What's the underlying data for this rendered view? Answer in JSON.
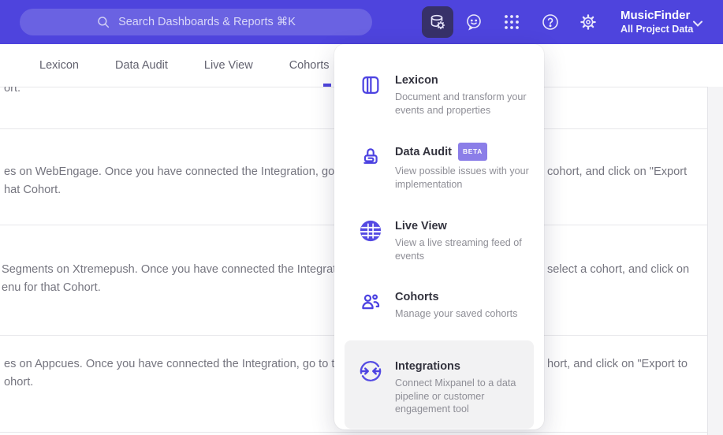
{
  "header": {
    "search_placeholder": "Search Dashboards & Reports ⌘K",
    "project_name": "MusicFinder",
    "project_scope": "All Project Data",
    "icons": [
      "data-management",
      "feedback-smiley",
      "apps-grid",
      "help",
      "settings",
      "chevron-down"
    ]
  },
  "tabs": {
    "items": [
      "Lexicon",
      "Data Audit",
      "Live View",
      "Cohorts"
    ]
  },
  "menu": {
    "items": [
      {
        "icon": "book-icon",
        "title": "Lexicon",
        "description": "Document and transform your events and properties"
      },
      {
        "icon": "lock-icon",
        "title": "Data Audit",
        "badge": "BETA",
        "description": "View possible issues with your implementation"
      },
      {
        "icon": "globe-icon",
        "title": "Live View",
        "description": "View a live streaming feed of events"
      },
      {
        "icon": "people-icon",
        "title": "Cohorts",
        "description": "Manage your saved cohorts"
      },
      {
        "icon": "integrations-icon",
        "title": "Integrations",
        "description": "Connect Mixpanel to a data pipeline or customer engagement tool",
        "highlighted": true
      }
    ]
  },
  "content": {
    "row1_line1": "ort.",
    "row2_left1": "es on WebEngage. Once you have connected the Integration, go to the",
    "row2_right1": "cohort, and click on \"Export",
    "row2_left2": "hat Cohort.",
    "row3_left1": "Segments on Xtremepush. Once you have connected the Integration,",
    "row3_right1": "select a cohort, and click on",
    "row3_left2": "enu for that Cohort.",
    "row4_left1": "es on Appcues. Once you have connected the Integration, go to the M",
    "row4_right1": "hort, and click on \"Export to",
    "row4_left2": "ohort."
  },
  "colors": {
    "header_bg": "#4e44dd",
    "accent_purple": "#4c42e1",
    "active_button_bg": "#373169",
    "beta_badge_bg": "#8b7ee8",
    "highlight_row_bg": "#f2f2f3",
    "body_text_gray": "#75757f"
  }
}
